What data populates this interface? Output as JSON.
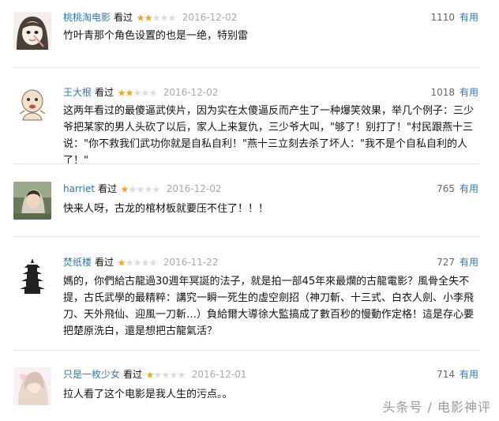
{
  "comments": [
    {
      "author": "桃桃淘电影",
      "action": "看过",
      "rating_stars": 2,
      "date": "2016-12-02",
      "votes": "1110",
      "useful_label": "有用",
      "text": "竹叶青那个角色设置的也是一绝，特别雷"
    },
    {
      "author": "王大根",
      "action": "看过",
      "rating_stars": 2,
      "date": "2016-12-02",
      "votes": "1018",
      "useful_label": "有用",
      "text": "这两年看过的最傻逼武侠片，因为实在太傻逼反而产生了一种爆笑效果，举几个例子：三少爷把某家的男人头砍了以后，家人上来复仇，三少爷大叫，\"够了！别打了！\"村民跟燕十三说：\"你不救我们武功你就是自私自利！\"燕十三立刻去杀了坏人：\"我不是个自私自利的人了！\""
    },
    {
      "author": "harriet",
      "action": "看过",
      "rating_stars": 1,
      "date": "2016-12-02",
      "votes": "765",
      "useful_label": "有用",
      "text": "快来人呀，古龙的棺材板就要压不住了！！！"
    },
    {
      "author": "焚纸楼",
      "action": "看过",
      "rating_stars": 1,
      "date": "2016-11-22",
      "votes": "727",
      "useful_label": "有用",
      "text": "媽的，你們給古龍過30週年冥誕的法子，就是拍一部45年來最爛的古龍電影？風骨全失不提，古氏武學的最精粹：講究一瞬一死生的虛空劍招（神刀斬、十三式、白衣人劍、小李飛刀、天外飛仙、迎風一刀斬…）負給爾大導徐大監搞成了數百秒的慢動作定格！這是存心要把楚原洗白，還是想把古龍氣活？"
    },
    {
      "author": "只是一枚少女",
      "action": "看过",
      "rating_stars": 1,
      "date": "2016-12-01",
      "votes": "714",
      "useful_label": "有用",
      "text": "拉人看了这个电影是我人生的污点。。"
    }
  ],
  "watermark": "头条号 / 电影神评",
  "colors": {
    "link": "#3377aa",
    "star_filled": "#f5a623",
    "star_empty": "#dcdcdc",
    "date": "#aaaaaa",
    "divider": "#e6e6e6"
  }
}
